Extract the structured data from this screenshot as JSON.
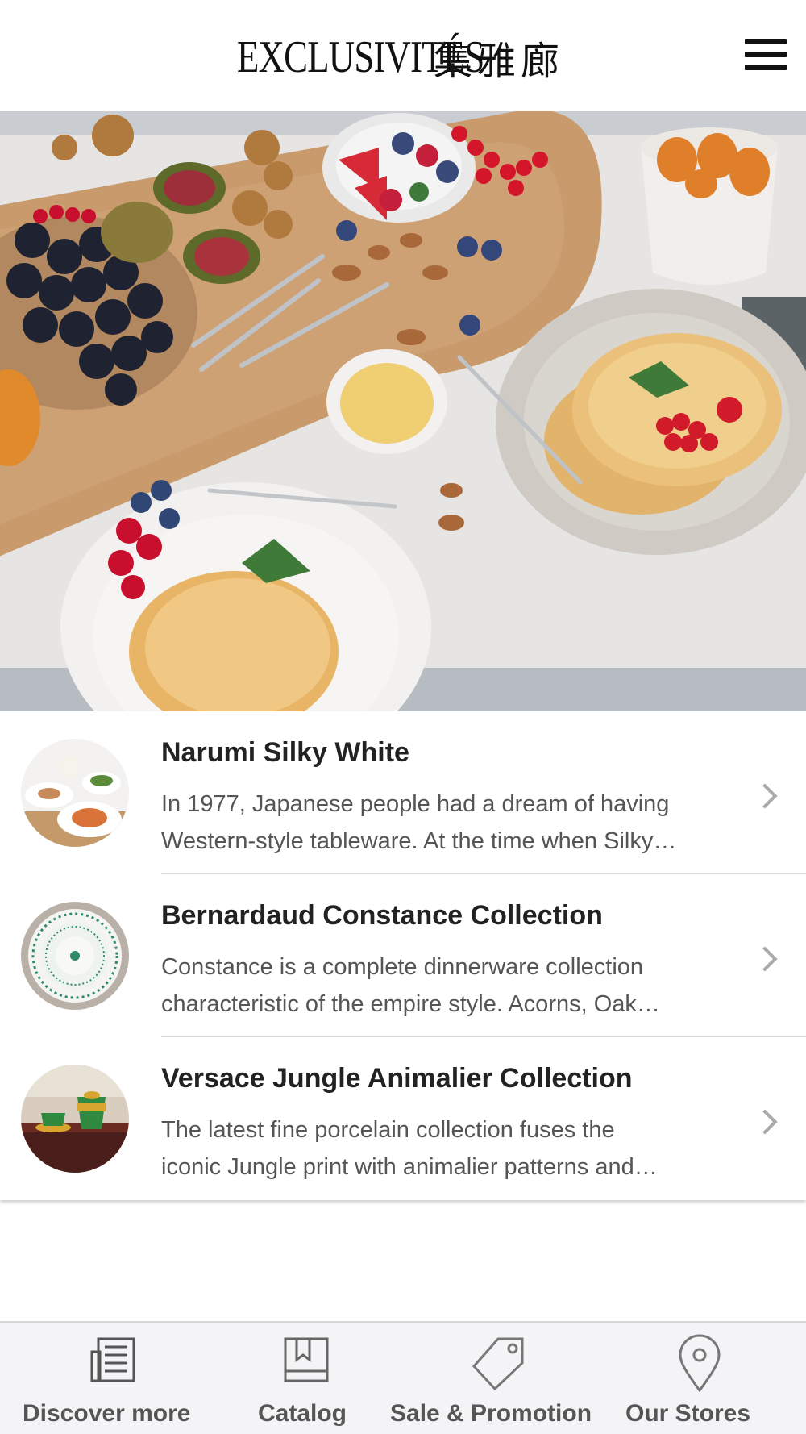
{
  "header": {
    "logo_latin": "EXCLUSIVITÉS",
    "logo_chinese": "集雅廊",
    "menu_icon": "hamburger-menu-icon"
  },
  "hero": {
    "description_icon": "hero-banner-image"
  },
  "collections": [
    {
      "title": "Narumi Silky White",
      "desc_line1": "In 1977, Japanese people had a dream of having",
      "desc_line2": "Western-style tableware. At the time when Silky…"
    },
    {
      "title": "Bernardaud Constance Collection",
      "desc_line1": "Constance is a complete dinnerware collection",
      "desc_line2": "characteristic of the empire style.  Acorns, Oak…"
    },
    {
      "title": "Versace Jungle Animalier Collection",
      "desc_line1": "The latest fine porcelain collection fuses the",
      "desc_line2": "iconic Jungle print with animalier patterns and…"
    }
  ],
  "tabbar": {
    "tabs": [
      {
        "label": "Discover more",
        "icon": "newspaper-icon"
      },
      {
        "label": "Catalog",
        "icon": "book-icon"
      },
      {
        "label": "Sale & Promotion",
        "icon": "price-tag-icon"
      },
      {
        "label": "Our Stores",
        "icon": "location-pin-icon"
      }
    ]
  },
  "colors": {
    "text_dark": "#222222",
    "text_muted": "#555555",
    "divider": "#d9d9d9",
    "tabbar_bg": "#f4f4f6",
    "chevron": "#aaaaaa"
  }
}
